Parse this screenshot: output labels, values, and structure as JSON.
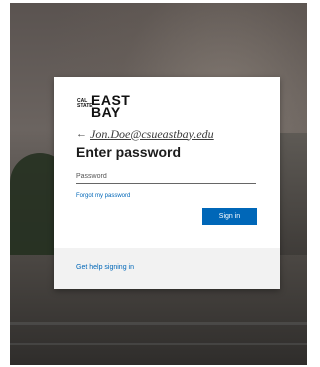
{
  "logo": {
    "small_text": "CAL\nSTATE",
    "big_text": "EAST\nBAY"
  },
  "account": {
    "email": "Jon.Doe@csueastbay.edu",
    "back_icon": "arrow-left-icon"
  },
  "form": {
    "title": "Enter password",
    "password_placeholder": "Password",
    "forgot_link": "Forgot my password",
    "signin_label": "Sign in"
  },
  "footer": {
    "help_link": "Get help signing in"
  },
  "colors": {
    "accent": "#0067b8",
    "footer_bg": "#f2f2f2"
  }
}
